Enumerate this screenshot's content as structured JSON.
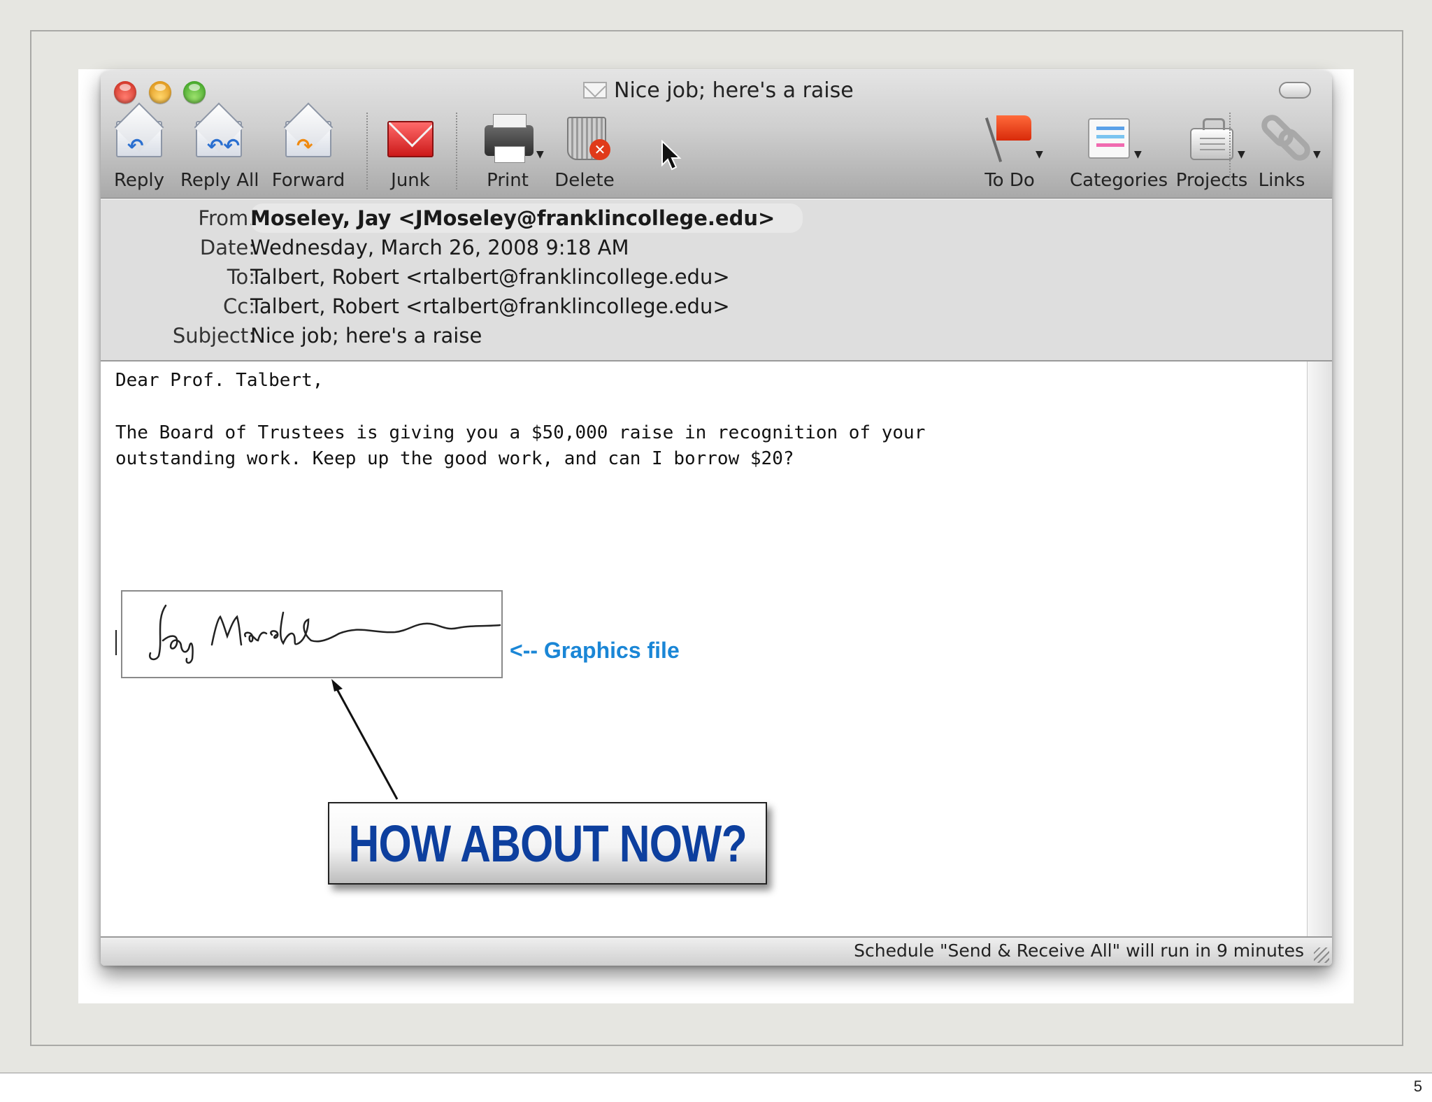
{
  "window": {
    "title": "Nice job; here's a raise"
  },
  "toolbar": {
    "reply": "Reply",
    "reply_all": "Reply All",
    "forward": "Forward",
    "junk": "Junk",
    "print": "Print",
    "delete": "Delete",
    "todo": "To Do",
    "categories": "Categories",
    "projects": "Projects",
    "links": "Links"
  },
  "header": {
    "from_label": "From:",
    "from_value": "Moseley, Jay <JMoseley@franklincollege.edu>",
    "date_label": "Date:",
    "date_value": "Wednesday, March 26, 2008 9:18 AM",
    "to_label": "To:",
    "to_value": "Talbert, Robert <rtalbert@franklincollege.edu>",
    "cc_label": "Cc:",
    "cc_value": "Talbert, Robert <rtalbert@franklincollege.edu>",
    "subject_label": "Subject:",
    "subject_value": "Nice job; here's a raise"
  },
  "body": {
    "greeting": "Dear Prof. Talbert,",
    "line1": "The Board of Trustees is giving you a $50,000 raise in recognition of your",
    "line2": "outstanding work. Keep up the good work, and can I borrow $20?",
    "signature_text": "Jay Marsh"
  },
  "annotations": {
    "graphics_label": "<-- Graphics file",
    "callout": "HOW ABOUT NOW?"
  },
  "status": {
    "text": "Schedule \"Send & Receive All\" will run in 9 minutes"
  },
  "slide": {
    "number": "5"
  },
  "colors": {
    "slide_background": "#e6e6e1",
    "annotation_blue": "#1a86d6",
    "callout_blue": "#0d3f9e"
  }
}
